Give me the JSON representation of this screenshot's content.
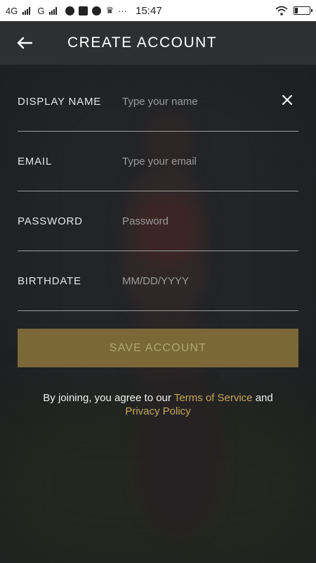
{
  "status_bar": {
    "network1": "4G",
    "network2": "G",
    "time": "15:47",
    "more": "···"
  },
  "header": {
    "title": "CREATE ACCOUNT"
  },
  "form": {
    "display_name": {
      "label": "DISPLAY NAME",
      "placeholder": "Type your name"
    },
    "email": {
      "label": "EMAIL",
      "placeholder": "Type your email"
    },
    "password": {
      "label": "PASSWORD",
      "placeholder": "Password"
    },
    "birthdate": {
      "label": "BIRTHDATE",
      "placeholder": "MM/DD/YYYY"
    }
  },
  "save_button": {
    "label": "SAVE ACCOUNT"
  },
  "legal": {
    "prefix": "By joining, you agree to our",
    "terms": "Terms of Service",
    "and": "and",
    "privacy": "Privacy Policy"
  },
  "colors": {
    "accent": "#c6a85a",
    "button": "#7a6838",
    "appbar": "#2e2f30"
  },
  "icons": [
    "back-arrow-icon",
    "clear-icon",
    "wifi-icon",
    "battery-icon"
  ]
}
